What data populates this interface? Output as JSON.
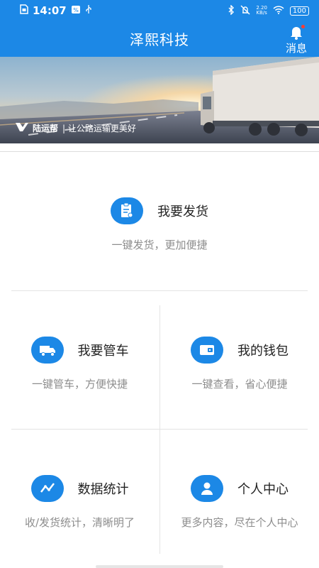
{
  "status_bar": {
    "time": "14:07",
    "net_speed": "2.20\nKB/s",
    "battery": "100"
  },
  "header": {
    "title": "泽熙科技",
    "message_label": "消息"
  },
  "banner": {
    "brand": "陆运帮",
    "slogan": "| 让公路运输更美好"
  },
  "cards": {
    "ship": {
      "title": "我要发货",
      "desc": "一键发货，更加便捷"
    },
    "vehicle": {
      "title": "我要管车",
      "desc": "一键管车，方便快捷"
    },
    "wallet": {
      "title": "我的钱包",
      "desc": "一键查看，省心便捷"
    },
    "stats": {
      "title": "数据统计",
      "desc": "收/发货统计，清晰明了"
    },
    "profile": {
      "title": "个人中心",
      "desc": "更多内容，尽在个人中心"
    }
  },
  "colors": {
    "primary": "#1c88e6",
    "muted_text": "#8d8d8d",
    "badge": "#ff3b30"
  }
}
